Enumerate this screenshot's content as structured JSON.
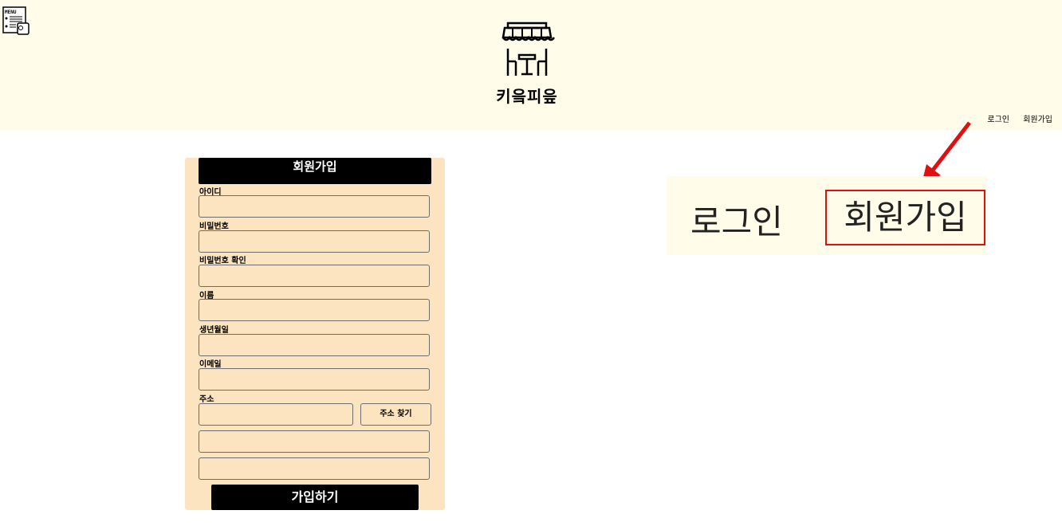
{
  "header": {
    "logo_text": "키읔피읖",
    "menu_icon": "menu-card-icon",
    "logo_icon": "cafe-awning-table-icon",
    "background": "#fffde9"
  },
  "nav": {
    "login": "로그인",
    "signup": "회원가입"
  },
  "signup_form": {
    "title": "회원가입",
    "fields": [
      {
        "label": "아이디",
        "value": ""
      },
      {
        "label": "비밀번호",
        "value": ""
      },
      {
        "label": "비밀번호 확인",
        "value": ""
      },
      {
        "label": "이름",
        "value": ""
      },
      {
        "label": "생년월일",
        "value": ""
      },
      {
        "label": "이메일",
        "value": ""
      }
    ],
    "address": {
      "label": "주소",
      "search_button": "주소 찾기",
      "values": [
        "",
        "",
        ""
      ]
    },
    "submit": "가입하기",
    "background": "#fbe4bf"
  },
  "callout": {
    "login": "로그인",
    "signup": "회원가입",
    "highlight_color": "#e01010"
  }
}
